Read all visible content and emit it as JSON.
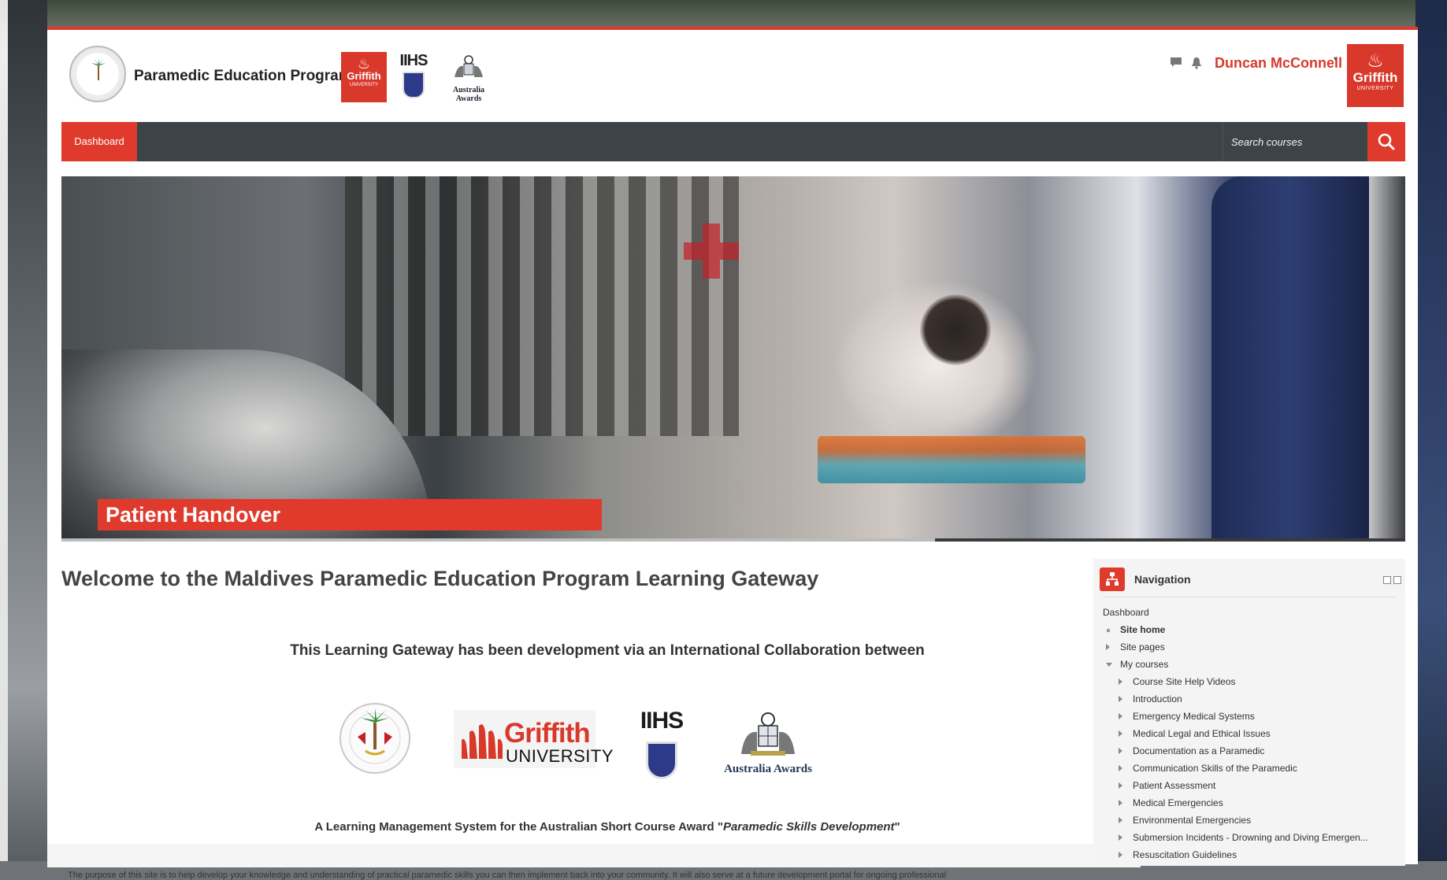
{
  "header": {
    "site_name": "Paramedic Education Program",
    "griffith_small": {
      "name": "Griffith",
      "sub": "UNIVERSITY"
    },
    "iihs_small": "IIHS",
    "aus_small": "Australia Awards",
    "user_name": "Duncan McConnell",
    "griffith_big": {
      "name": "Griffith",
      "sub": "UNIVERSITY"
    }
  },
  "navbar": {
    "dashboard_label": "Dashboard",
    "search_placeholder": "Search courses"
  },
  "hero": {
    "caption": "Patient Handover",
    "progress": 0.65
  },
  "main": {
    "welcome_title": "Welcome to the Maldives Paramedic Education Program Learning Gateway",
    "collab_line": "This Learning Gateway has been development via an International Collaboration between",
    "partners": {
      "griffith_name": "Griffith",
      "griffith_uni": "UNIVERSITY",
      "iihs": "IIHS",
      "australia_awards": "Australia Awards"
    },
    "lms_line_prefix": "A Learning Management System for the Australian Short Course Award \"",
    "lms_line_emph": "Paramedic Skills Development",
    "lms_line_suffix": "\"",
    "purpose_text": "The purpose of this site is to help develop your knowledge and understanding of practical paramedic skills you can then implement back into your community. It will also serve at a future development portal for ongoing professional"
  },
  "navigation": {
    "title": "Navigation",
    "dashboard": "Dashboard",
    "site_home": "Site home",
    "site_pages": "Site pages",
    "my_courses": "My courses",
    "courses": [
      "Course Site Help Videos",
      "Introduction",
      "Emergency Medical Systems",
      "Medical Legal and Ethical Issues",
      "Documentation as a Paramedic",
      "Communication Skills of the Paramedic",
      "Patient Assessment",
      "Medical Emergencies",
      "Environmental Emergencies",
      "Submersion Incidents - Drowning and Diving Emergen...",
      "Resuscitation Guidelines"
    ]
  },
  "colors": {
    "accent": "#e03a2d",
    "navbar": "#3d4448",
    "griffith_red": "#d9392b"
  }
}
